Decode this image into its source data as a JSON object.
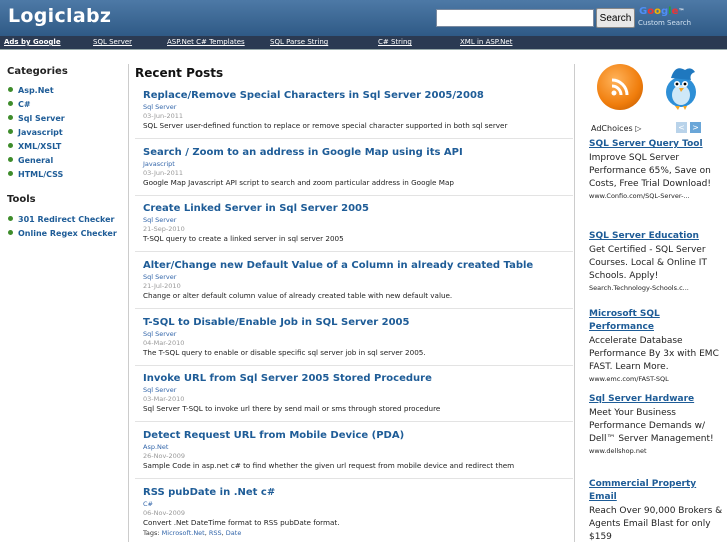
{
  "header": {
    "logo": "Logiclabz",
    "search_button": "Search",
    "google_letters": [
      "G",
      "o",
      "o",
      "g",
      "l",
      "e"
    ],
    "custom_search": "Custom Search",
    "tm": "™"
  },
  "adbar": {
    "ads_by": "Ads by Google",
    "links": [
      "SQL Server",
      "ASP.Net C# Templates",
      "SQL Parse String",
      "C# String",
      "XML in ASP.Net"
    ]
  },
  "sidebar": {
    "categories_title": "Categories",
    "categories": [
      "Asp.Net",
      "C#",
      "Sql Server",
      "Javascript",
      "XML/XSLT",
      "General",
      "HTML/CSS"
    ],
    "tools_title": "Tools",
    "tools": [
      "301 Redirect Checker",
      "Online Regex Checker"
    ]
  },
  "main": {
    "title": "Recent Posts",
    "posts": [
      {
        "title": "Replace/Remove Special Characters in Sql Server 2005/2008",
        "category": "Sql Server",
        "date": "03-Jun-2011",
        "desc": "SQL Server user-defined function to replace or remove special character supported in both sql server"
      },
      {
        "title": "Search / Zoom to an address in Google Map using its API",
        "category": "Javascript",
        "date": "03-Jun-2011",
        "desc": "Google Map Javascript API script to search and zoom particular address in Google Map"
      },
      {
        "title": "Create Linked Server in Sql Server 2005",
        "category": "Sql Server",
        "date": "21-Sep-2010",
        "desc": "T-SQL query to create a linked server in sql server 2005"
      },
      {
        "title": "Alter/Change new Default Value of a Column in already created Table",
        "category": "Sql Server",
        "date": "21-Jul-2010",
        "desc": "Change or alter default column value of already created table with new default value."
      },
      {
        "title": "T-SQL to Disable/Enable Job in SQL Server 2005",
        "category": "Sql Server",
        "date": "04-Mar-2010",
        "desc": "The T-SQL query to enable or disable specific sql server job in sql server 2005."
      },
      {
        "title": "Invoke URL from Sql Server 2005 Stored Procedure",
        "category": "Sql Server",
        "date": "03-Mar-2010",
        "desc": "Sql Server T-SQL to invoke url there by send mail or sms through stored procedure"
      },
      {
        "title": "Detect Request URL from Mobile Device (PDA)",
        "category": "Asp.Net",
        "date": "26-Nov-2009",
        "desc": "Sample Code in asp.net c# to find whether the given url request from mobile device and redirect them"
      },
      {
        "title": "RSS pubDate in .Net c#",
        "category": "C#",
        "date": "06-Nov-2009",
        "desc": "Convert .Net DateTime format to RSS pubDate format.",
        "tags_label": "Tags:",
        "tags": [
          "Microsoft.Net",
          "RSS",
          "Date"
        ]
      }
    ]
  },
  "right": {
    "adchoices": "AdChoices",
    "prev": "<",
    "next": ">",
    "ads": [
      {
        "title": "SQL Server Query Tool",
        "body": "Improve SQL Server Performance 65%, Save on Costs, Free Trial Download!",
        "url": "www.Confio.com/SQL-Server-..."
      },
      {
        "title": "SQL Server Education",
        "body": "Get Certified - SQL Server Courses. Local & Online IT Schools. Apply!",
        "url": "Search.Technology-Schools.c..."
      },
      {
        "title": "Microsoft SQL Performance",
        "body": "Accelerate Database Performance By 3x with EMC FAST. Learn More.",
        "url": "www.emc.com/FAST-SQL"
      },
      {
        "title": "Sql Server Hardware",
        "body": "Meet Your Business Performance Demands w/ Dell™ Server Management!",
        "url": "www.dellshop.net"
      },
      {
        "title": "Commercial Property Email",
        "body": "Reach Over 90,000 Brokers & Agents Email Blast for only $159",
        "url": ""
      }
    ]
  }
}
